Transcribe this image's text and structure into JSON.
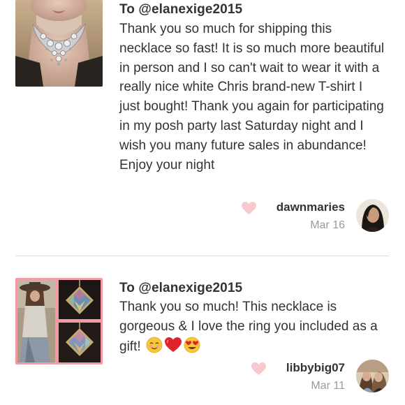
{
  "notes": [
    {
      "recipient": "To @elanexige2015",
      "message": "Thank you so much for shipping this necklace so fast! It is so much more beautiful in person and I so can't wait to wear it with a really nice white Chris brand-new T-shirt I just bought! Thank you again for participating in my posh party last Saturday night and I wish you many future sales in abundance! Enjoy your night",
      "username": "dawnmaries",
      "date": "Mar 16",
      "heart_icon": "heart-icon",
      "heart_color": "#f8c8cf"
    },
    {
      "recipient": "To @elanexige2015",
      "message": "Thank you so much! This necklace is gorgeous & I love the ring you included as a gift!",
      "emojis": [
        "smiling-face-emoji",
        "red-heart-emoji",
        "heart-eyes-emoji"
      ],
      "username": "libbybig07",
      "date": "Mar 11",
      "heart_icon": "heart-icon",
      "heart_color": "#f8c8cf"
    }
  ],
  "colors": {
    "text": "#333333",
    "date": "#9a9a9a",
    "divider": "#dcdcdc",
    "collage_border": "#f39aa5"
  }
}
